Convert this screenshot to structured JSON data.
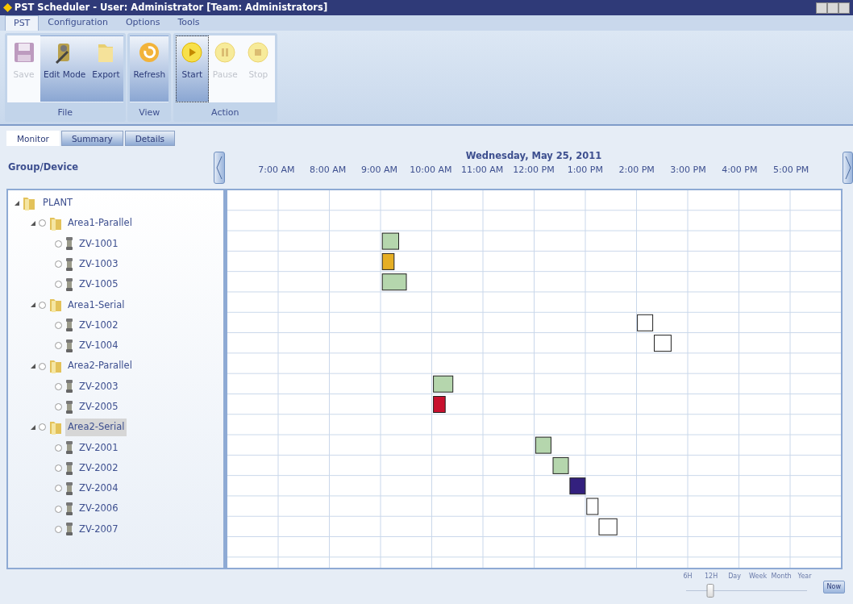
{
  "window": {
    "title": "PST Scheduler - User: Administrator [Team: Administrators]"
  },
  "menu": [
    {
      "label": "PST",
      "selected": true
    },
    {
      "label": "Configuration",
      "selected": false
    },
    {
      "label": "Options",
      "selected": false
    },
    {
      "label": "Tools",
      "selected": false
    }
  ],
  "ribbon": {
    "groups": [
      {
        "label": "File",
        "buttons": [
          {
            "label": "Save",
            "kind": "save",
            "disabled": true,
            "focused": false
          },
          {
            "label": "Edit Mode",
            "kind": "edit",
            "disabled": false,
            "focused": false
          },
          {
            "label": "Export",
            "kind": "export",
            "disabled": false,
            "focused": false
          }
        ]
      },
      {
        "label": "View",
        "buttons": [
          {
            "label": "Refresh",
            "kind": "refresh",
            "disabled": false,
            "focused": false
          }
        ]
      },
      {
        "label": "Action",
        "buttons": [
          {
            "label": "Start",
            "kind": "start",
            "disabled": false,
            "focused": true
          },
          {
            "label": "Pause",
            "kind": "pause",
            "disabled": true,
            "focused": false
          },
          {
            "label": "Stop",
            "kind": "stop",
            "disabled": true,
            "focused": false
          }
        ]
      }
    ]
  },
  "view_tabs": [
    {
      "label": "Monitor",
      "selected": true
    },
    {
      "label": "Summary",
      "selected": false
    },
    {
      "label": "Details",
      "selected": false
    }
  ],
  "tree_header": "Group/Device",
  "tree": [
    {
      "label": "PLANT",
      "kind": "root",
      "expanded": true,
      "selected": false,
      "children": [
        {
          "label": "Area1-Parallel",
          "kind": "group",
          "checked": false,
          "expanded": true,
          "selected": false,
          "children": [
            {
              "label": "ZV-1001",
              "kind": "device",
              "checked": false,
              "selected": false,
              "color": "#b5d6ad"
            },
            {
              "label": "ZV-1003",
              "kind": "device",
              "checked": false,
              "selected": false,
              "color": "#e5ae25"
            },
            {
              "label": "ZV-1005",
              "kind": "device",
              "checked": false,
              "selected": false,
              "color": "#b5d6ad"
            }
          ]
        },
        {
          "label": "Area1-Serial",
          "kind": "group",
          "checked": false,
          "expanded": true,
          "selected": false,
          "children": [
            {
              "label": "ZV-1002",
              "kind": "device",
              "checked": false,
              "selected": false,
              "color": "#ffffff"
            },
            {
              "label": "ZV-1004",
              "kind": "device",
              "checked": false,
              "selected": false,
              "color": "#ffffff"
            }
          ]
        },
        {
          "label": "Area2-Parallel",
          "kind": "group",
          "checked": false,
          "expanded": true,
          "selected": false,
          "children": [
            {
              "label": "ZV-2003",
              "kind": "device",
              "checked": false,
              "selected": false,
              "color": "#b5d6ad"
            },
            {
              "label": "ZV-2005",
              "kind": "device",
              "checked": false,
              "selected": false,
              "color": "#c8102e"
            }
          ]
        },
        {
          "label": "Area2-Serial",
          "kind": "group",
          "checked": false,
          "expanded": true,
          "selected": true,
          "children": [
            {
              "label": "ZV-2001",
              "kind": "device",
              "checked": false,
              "selected": false,
              "color": "#b5d6ad"
            },
            {
              "label": "ZV-2002",
              "kind": "device",
              "checked": false,
              "selected": false,
              "color": "#b5d6ad"
            },
            {
              "label": "ZV-2004",
              "kind": "device",
              "checked": false,
              "selected": false,
              "color": "#33207e"
            },
            {
              "label": "ZV-2006",
              "kind": "device",
              "checked": false,
              "selected": false,
              "color": "#ffffff"
            },
            {
              "label": "ZV-2007",
              "kind": "device",
              "checked": false,
              "selected": false,
              "color": "#ffffff"
            }
          ]
        }
      ]
    }
  ],
  "timeline": {
    "date": "Wednesday, May 25, 2011",
    "hours": [
      "7:00 AM",
      "8:00 AM",
      "9:00 AM",
      "10:00 AM",
      "11:00 AM",
      "12:00 PM",
      "1:00 PM",
      "2:00 PM",
      "3:00 PM",
      "4:00 PM",
      "5:00 PM"
    ]
  },
  "zoom": {
    "labels": [
      "6H",
      "12H",
      "Day",
      "Week",
      "Month",
      "Year"
    ],
    "level": 0.2,
    "now_button": "Now"
  }
}
